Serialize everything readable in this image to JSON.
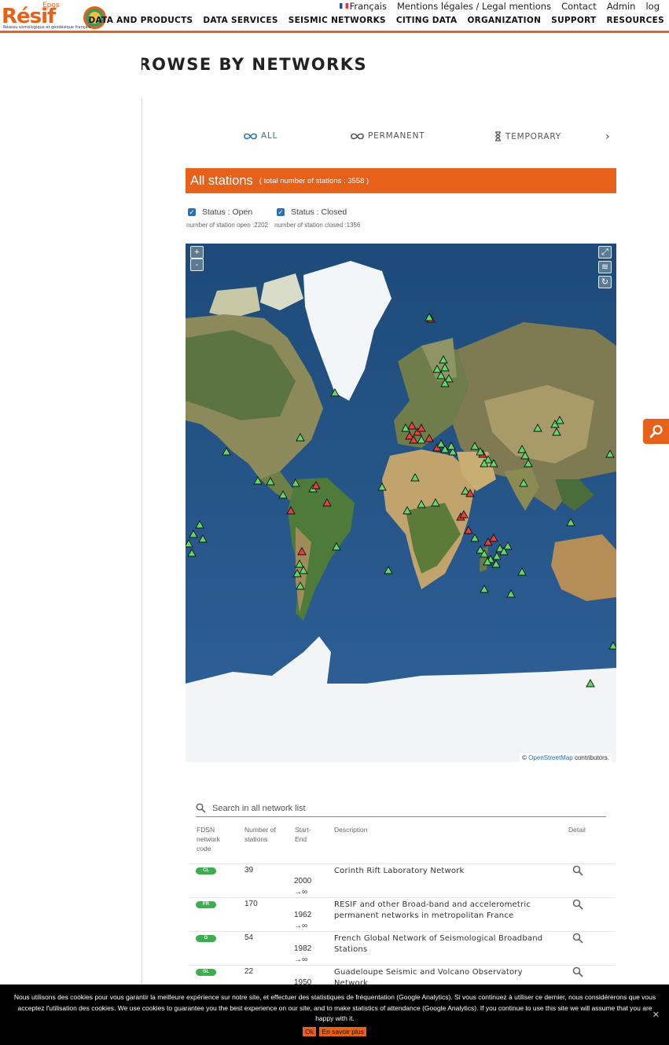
{
  "header": {
    "logo_epos": "Epos",
    "logo_name": "Résif",
    "logo_tagline": "Réseau sismologique et géodésique français",
    "language": "Français",
    "legal": "Mentions légales / Legal mentions",
    "contact": "Contact",
    "admin": "Admin",
    "login": "log",
    "nav": [
      "DATA AND PRODUCTS",
      "DATA SERVICES",
      "SEISMIC NETWORKS",
      "CITING DATA",
      "ORGANIZATION",
      "SUPPORT",
      "RESOURCES"
    ]
  },
  "page": {
    "title": "BROWSE BY NETWORKS"
  },
  "tabs": {
    "all": "ALL",
    "permanent": "PERMANENT",
    "temporary": "TEMPORARY"
  },
  "banner": {
    "title": "All stations",
    "subtitle": "( total number of stations : 3558 )"
  },
  "status": {
    "open_label": "Status : Open",
    "closed_label": "Status : Closed",
    "open_count": "number of station open :2202",
    "closed_count": "number of station closed :1356"
  },
  "map": {
    "zoom_in": "+",
    "zoom_out": "-",
    "attribution_prefix": "©",
    "attribution_link": "OpenStreetMap",
    "attribution_suffix": "contributors.",
    "open_color": "#5fd86a",
    "closed_color": "#e8413b"
  },
  "search": {
    "placeholder": "Search in all network list"
  },
  "table": {
    "headers": {
      "code": "FDSN network code",
      "stations": "Number of stations",
      "startend": "Start-End",
      "description": "Description",
      "detail": "Detail"
    },
    "rows": [
      {
        "code": "CL",
        "stations": "39",
        "start": "2000",
        "end": "→∞",
        "description": "Corinth Rift Laboratory Network"
      },
      {
        "code": "FR",
        "stations": "170",
        "start": "1962",
        "end": "→∞",
        "description": "RESIF and other Broad-band and accelerometric permanent networks in metropolitan France"
      },
      {
        "code": "G",
        "stations": "54",
        "start": "1982",
        "end": "→∞",
        "description": "French Global Network of Seismological Broadband Stations"
      },
      {
        "code": "GL",
        "stations": "22",
        "start": "1950",
        "end": "",
        "description": "Guadeloupe Seismic and Volcano Observatory Network"
      }
    ]
  },
  "cookie": {
    "text": "Nous utilisons des cookies pour vous garantir la meilleure expérience sur notre site, et effectuer des statistiques de fréquentation (Google Analytics). Si vous continuez à utiliser ce dernier, nous considérerons que vous acceptez l'utilisation des cookies. We use cookies to guarantee you the best experience on our site, and to make statistics of attendance (Google Analytics). If you continue to use this site we will assume that you are happy with it.",
    "ok": "Ok",
    "more": "En savoir plus",
    "close": "✕"
  },
  "colors": {
    "accent": "#e8611a",
    "link": "#2a72b8",
    "badge": "#3cae50"
  }
}
